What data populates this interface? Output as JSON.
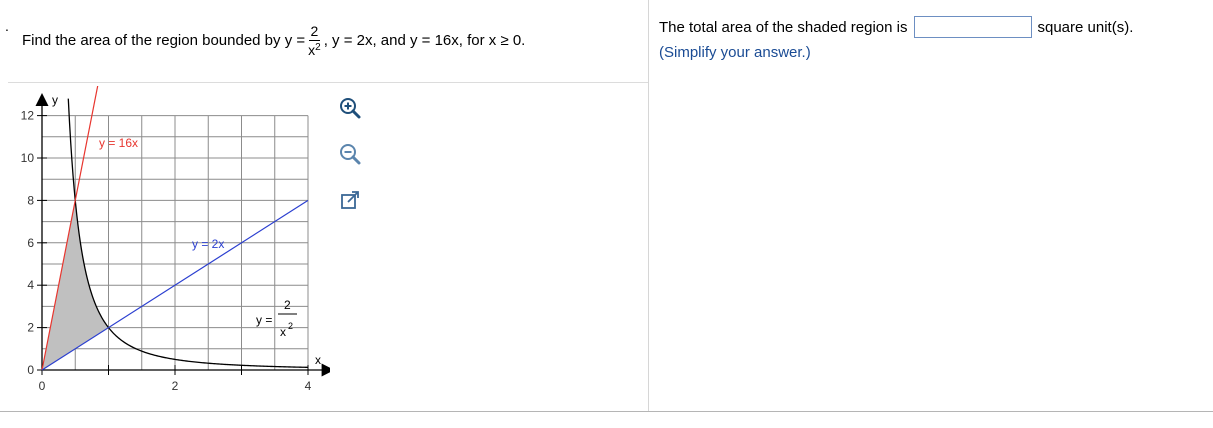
{
  "question": {
    "prefix": "Find the area of the region bounded by y =",
    "frac_num": "2",
    "frac_den": "x",
    "frac_exp": "2",
    "suffix": ", y = 2x, and y = 16x, for x ≥ 0."
  },
  "answer": {
    "prefix": "The total area of the shaded region is",
    "input_value": "",
    "suffix": "square unit(s).",
    "hint": "(Simplify your answer.)"
  },
  "graph": {
    "y_axis_label": "y",
    "x_axis_label": "x",
    "x_ticks": [
      "0",
      "2",
      "4"
    ],
    "y_ticks": [
      "0",
      "2",
      "4",
      "6",
      "8",
      "10",
      "12"
    ],
    "curve_labels": {
      "line16": "y = 16x",
      "line2": "y = 2x",
      "hyper_prefix": "y =",
      "hyper_num": "2",
      "hyper_den": "x",
      "hyper_exp": "2"
    },
    "colors": {
      "line16": "#e8352e",
      "line2": "#2b3fd0",
      "hyperbola": "#000000",
      "shade": "#c0c0c0",
      "grid": "#8c8c8c"
    }
  },
  "toolbar": {
    "zoom_in_icon": "zoom-in-icon",
    "zoom_out_icon": "zoom-out-icon",
    "popout_icon": "popout-icon"
  }
}
